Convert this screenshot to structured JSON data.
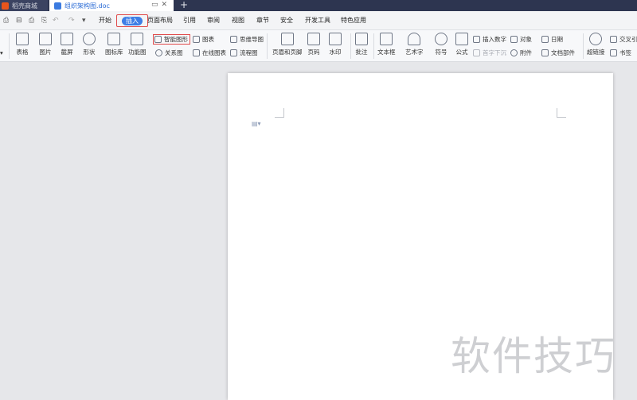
{
  "titlebar": {
    "tabs": [
      {
        "label": "稻壳商城"
      },
      {
        "label": "组织架构图.doc"
      }
    ],
    "new_tab": "+"
  },
  "quick_access": [
    "⎙",
    "⊟",
    "⎙",
    "↶",
    "↷",
    "▾"
  ],
  "menu": {
    "items": [
      "开始",
      "插入",
      "页面布局",
      "引用",
      "审阅",
      "视图",
      "章节",
      "安全",
      "开发工具",
      "特色应用"
    ],
    "active": "插入"
  },
  "ribbon": {
    "big_buttons": {
      "table": "表格",
      "image": "图片",
      "screenshot": "截屏",
      "shapes": "形状",
      "icons": "图标库",
      "function_chart": "功能图",
      "header_footer": "页眉和页脚",
      "page_number": "页码",
      "watermark": "水印",
      "comment": "批注",
      "textbox": "文本框",
      "wordart": "艺术字",
      "symbol": "符号",
      "formula": "公式",
      "hyperlink": "超链接"
    },
    "small_buttons": {
      "smartart": "智能图形",
      "chart": "图表",
      "mindmap": "思维导图",
      "relation": "关系图",
      "online_chart": "在线图表",
      "flowchart": "流程图",
      "insert_number": "插入数字",
      "object": "对象",
      "date": "日期",
      "first_drop": "首字下沉",
      "attachment": "附件",
      "doc_parts": "文档部件",
      "crossref": "交叉引",
      "bookmark": "书签"
    }
  },
  "document": {
    "watermark_text": "软件技巧"
  }
}
